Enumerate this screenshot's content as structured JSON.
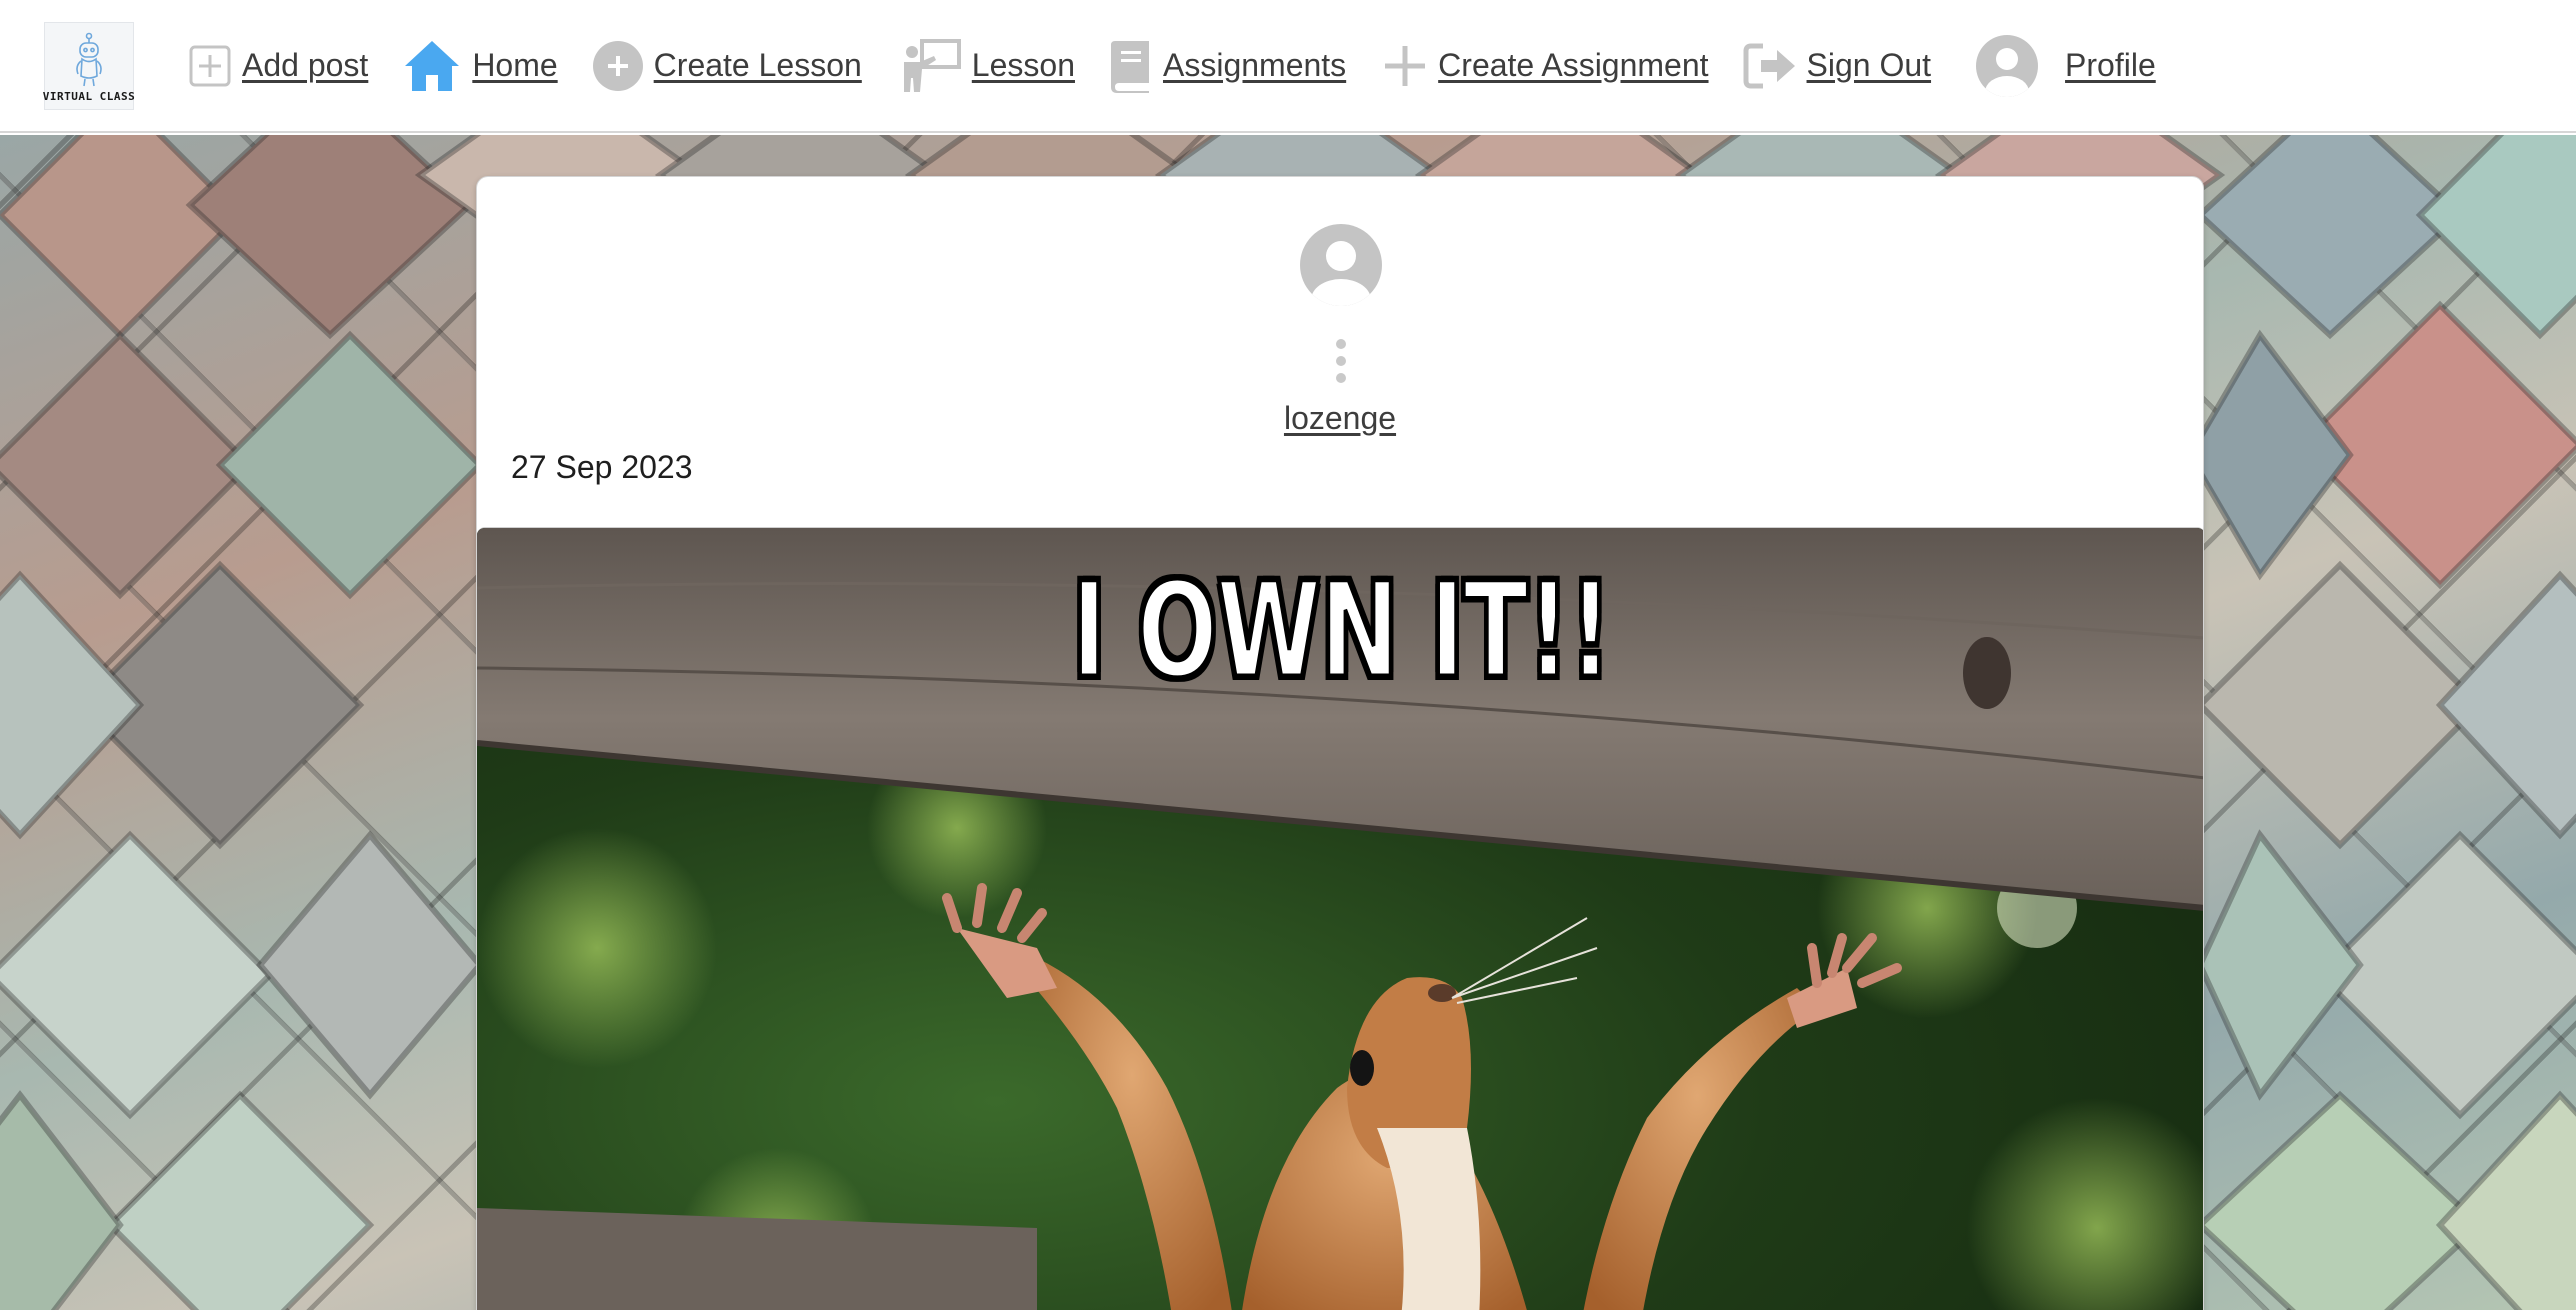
{
  "nav": {
    "logo_text": "VIRTUAL CLASS",
    "items": [
      {
        "label": "Add post",
        "icon": "plus-square-icon"
      },
      {
        "label": "Home",
        "icon": "home-icon"
      },
      {
        "label": "Create Lesson",
        "icon": "plus-circle-icon"
      },
      {
        "label": "Lesson",
        "icon": "teacher-board-icon"
      },
      {
        "label": "Assignments",
        "icon": "book-icon"
      },
      {
        "label": "Create Assignment",
        "icon": "plus-icon"
      },
      {
        "label": "Sign Out",
        "icon": "sign-out-icon"
      },
      {
        "label": "Profile",
        "icon": "user-avatar-icon"
      }
    ]
  },
  "post": {
    "author": "lozenge",
    "date": "27 Sep 2023",
    "image_caption": "I OWN IT!!"
  },
  "colors": {
    "accent_blue": "#4aa8f0",
    "icon_gray": "#c4c4c4",
    "text": "#3d3d3d"
  }
}
